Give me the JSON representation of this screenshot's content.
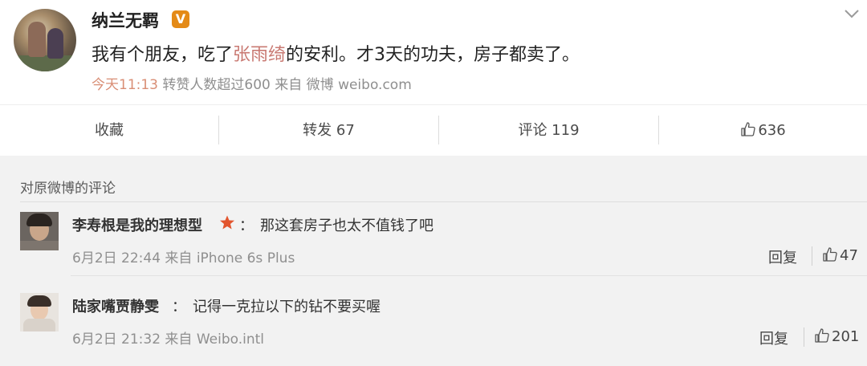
{
  "post": {
    "username": "纳兰无羁",
    "verified_badge": "V",
    "text_before": "我有个朋友，吃了",
    "mention": "张雨绮",
    "text_after": "的安利。才3天的功夫，房子都卖了。",
    "time": "今天11:13",
    "meta_rest": "转赞人数超过600 来自 微博 weibo.com",
    "colors": {
      "mention": "#c97a73",
      "time": "#d98e75",
      "badge": "#e48a17"
    }
  },
  "actions": {
    "favorite": "收藏",
    "repost": "转发 67",
    "comment": "评论 119",
    "like_count": "636"
  },
  "comments_section": {
    "title": "对原微博的评论",
    "items": [
      {
        "author": "李寿根是我的理想型",
        "has_star": true,
        "separator": "：",
        "text": "那这套房子也太不值钱了吧",
        "meta": "6月2日 22:44 来自 iPhone 6s Plus",
        "reply": "回复",
        "likes": "47"
      },
      {
        "author": "陆家嘴贾静雯",
        "has_star": false,
        "separator": "：",
        "text": "记得一克拉以下的钻不要买喔",
        "meta": "6月2日 21:32 来自 Weibo.intl",
        "reply": "回复",
        "likes": "201"
      }
    ]
  },
  "icons": [
    "chevron-down-icon",
    "thumbs-up-icon",
    "star-icon",
    "verified-badge-icon"
  ]
}
